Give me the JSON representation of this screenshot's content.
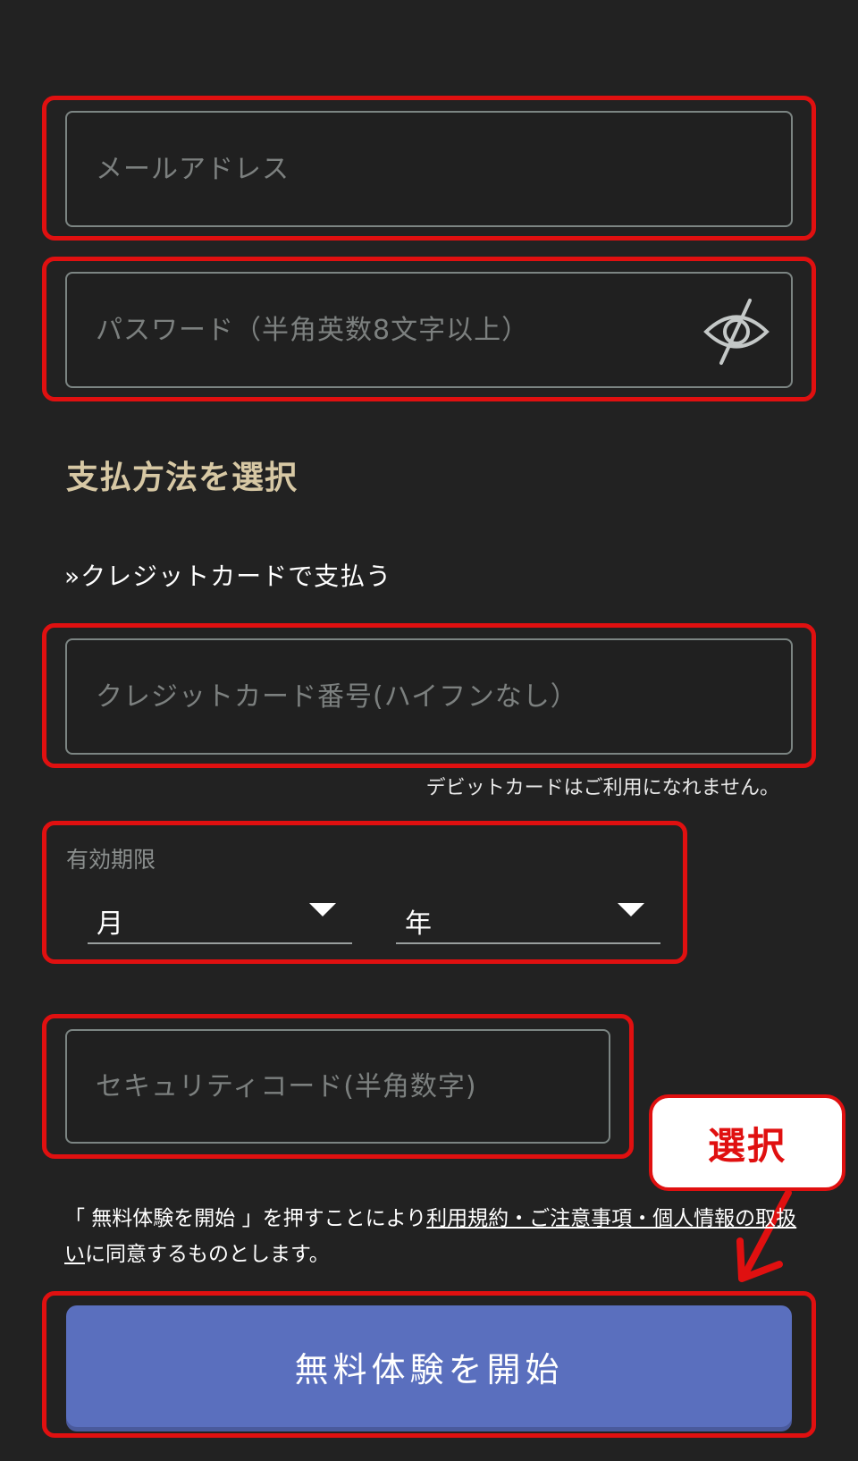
{
  "colors": {
    "background": "#222222",
    "highlight": "#e01010",
    "section_title": "#d7c8a4",
    "field_border": "#7c8583",
    "button": "#5a6fbe"
  },
  "email": {
    "placeholder": "メールアドレス"
  },
  "password": {
    "placeholder": "パスワード（半角英数8文字以上）",
    "toggle_icon": "eye-slash-icon"
  },
  "payment": {
    "title": "支払方法を選択",
    "credit_link": "»クレジットカードで支払う",
    "card_number_placeholder": "クレジットカード番号(ハイフンなし）",
    "debit_note": "デビットカードはご利用になれません。",
    "expiry": {
      "label": "有効期限",
      "month": "月",
      "year": "年"
    },
    "security_code_placeholder": "セキュリティコード(半角数字)"
  },
  "annotation": {
    "callout": "選択"
  },
  "terms": {
    "prefix": "「 無料体験を開始 」を押すことにより",
    "link": "利用規約・ご注意事項・個人情報の取扱い",
    "suffix": "に同意するものとします。"
  },
  "submit": {
    "label": "無料体験を開始"
  }
}
